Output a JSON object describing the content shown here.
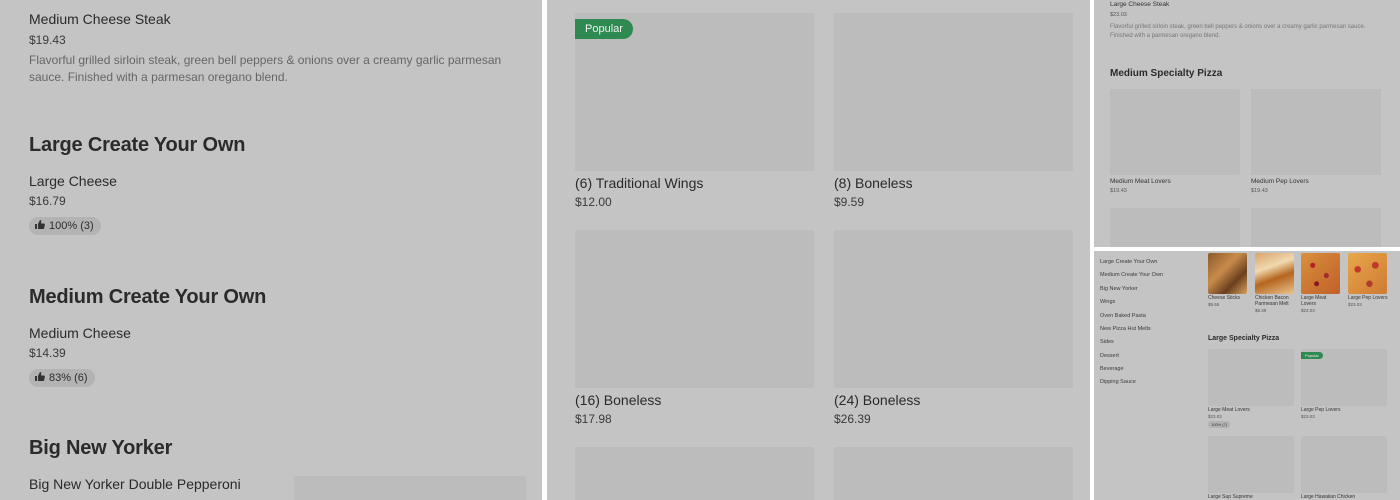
{
  "left": {
    "item1": {
      "name": "Medium Cheese Steak",
      "price": "$19.43",
      "description": "Flavorful grilled sirloin steak, green bell peppers & onions over a creamy garlic parmesan sauce. Finished with a parmesan oregano blend."
    },
    "section1": {
      "title": "Large Create Your Own",
      "item": {
        "name": "Large Cheese",
        "price": "$16.79",
        "rating": "100% (3)"
      }
    },
    "section2": {
      "title": "Medium Create Your Own",
      "item": {
        "name": "Medium Cheese",
        "price": "$14.39",
        "rating": "83% (6)"
      }
    },
    "section3": {
      "title": "Big New Yorker",
      "item": {
        "name": "Big New Yorker Double Pepperoni"
      }
    }
  },
  "middle": {
    "badge": "Popular",
    "items": [
      {
        "name": "(6) Traditional Wings",
        "price": "$12.00"
      },
      {
        "name": "(8) Boneless",
        "price": "$9.59"
      },
      {
        "name": "(16) Boneless",
        "price": "$17.98"
      },
      {
        "name": "(24) Boneless",
        "price": "$26.39"
      }
    ]
  },
  "top_right": {
    "item": {
      "name": "Large Cheese Steak",
      "price": "$23.03",
      "description": "Flavorful grilled sirloin steak, green bell peppers & onions over a creamy garlic parmesan sauce. Finished with a parmesan oregano blend."
    },
    "section_title": "Medium Specialty Pizza",
    "items": [
      {
        "name": "Medium Meat Lovers",
        "price": "$19.43"
      },
      {
        "name": "Medium Pep Lovers",
        "price": "$19.43"
      }
    ]
  },
  "bottom_right": {
    "sidebar": [
      "Large Create Your Own",
      "Medium Create Your Own",
      "Big New Yorker",
      "Wings",
      "Oven Baked Pasta",
      "New Pizza Hut Melts",
      "Sides",
      "Dessert",
      "Beverage",
      "Dipping Sauce"
    ],
    "top_items": [
      {
        "name": "Cheese Sticks",
        "price": "$9.55"
      },
      {
        "name": "Chicken Bacon Parmesan Melt",
        "price": "$8.39"
      },
      {
        "name": "Large Meat Lovers",
        "price": "$23.03"
      },
      {
        "name": "Large Pep Lovers",
        "price": "$23.03"
      }
    ],
    "section_title": "Large Specialty Pizza",
    "badge": "Popular",
    "items": [
      {
        "name": "Large Meat Lovers",
        "price": "$23.03",
        "rating": "100% (7)"
      },
      {
        "name": "Large Pep Lovers",
        "price": "$23.03"
      },
      {
        "name": "Large Sup Supreme"
      },
      {
        "name": "Large Hawaiian Chicken"
      }
    ]
  }
}
